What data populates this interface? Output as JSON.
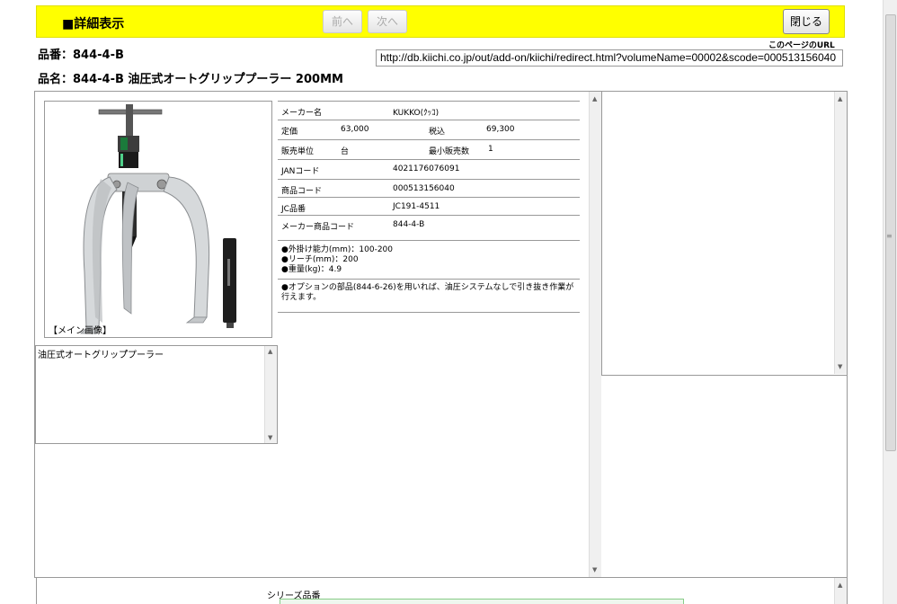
{
  "header": {
    "title": "■詳細表示",
    "prev_label": "前へ",
    "next_label": "次へ",
    "close_label": "閉じる"
  },
  "product": {
    "hinban": "品番：844-4-B",
    "hinmei": "品名：844-4-B 油圧式オートグリップ゚プーラー 200MM"
  },
  "page_url": {
    "label": "このページのURL",
    "value": "http://db.kiichi.co.jp/out/add-on/kiichi/redirect.html?volumeName=00002&scode=000513156040"
  },
  "image": {
    "caption": "【メイン画像】"
  },
  "description": "油圧式オートグリップ゚プーラー",
  "spec": {
    "maker_label": "メーカー名",
    "maker_value": "KUKKO(ｸｯｺ)",
    "list_price_label": "定価",
    "list_price_value": "63,000",
    "tax_label": "税込",
    "tax_value": "69,300",
    "unit_label": "販売単位",
    "unit_value": "台",
    "min_qty_label": "最小販売数",
    "min_qty_value": "1",
    "jan_label": "JANコード",
    "jan_value": "4021176076091",
    "code_label": "商品コード",
    "code_value": "000513156040",
    "jc_label": "JC品番",
    "jc_value": "JC191-4511",
    "maker_code_label": "メーカー商品コード",
    "maker_code_value": "844-4-B",
    "bullets": [
      "●外掛け能力(mm)：100-200",
      "●リーチ(mm)：200",
      "●重量(kg)：4.9"
    ],
    "note": "●オプションの部品(844-6-26)を用いれば、油圧システムなしで引き抜き作業が行えます。"
  },
  "series": {
    "label": "シリーズ品番"
  }
}
